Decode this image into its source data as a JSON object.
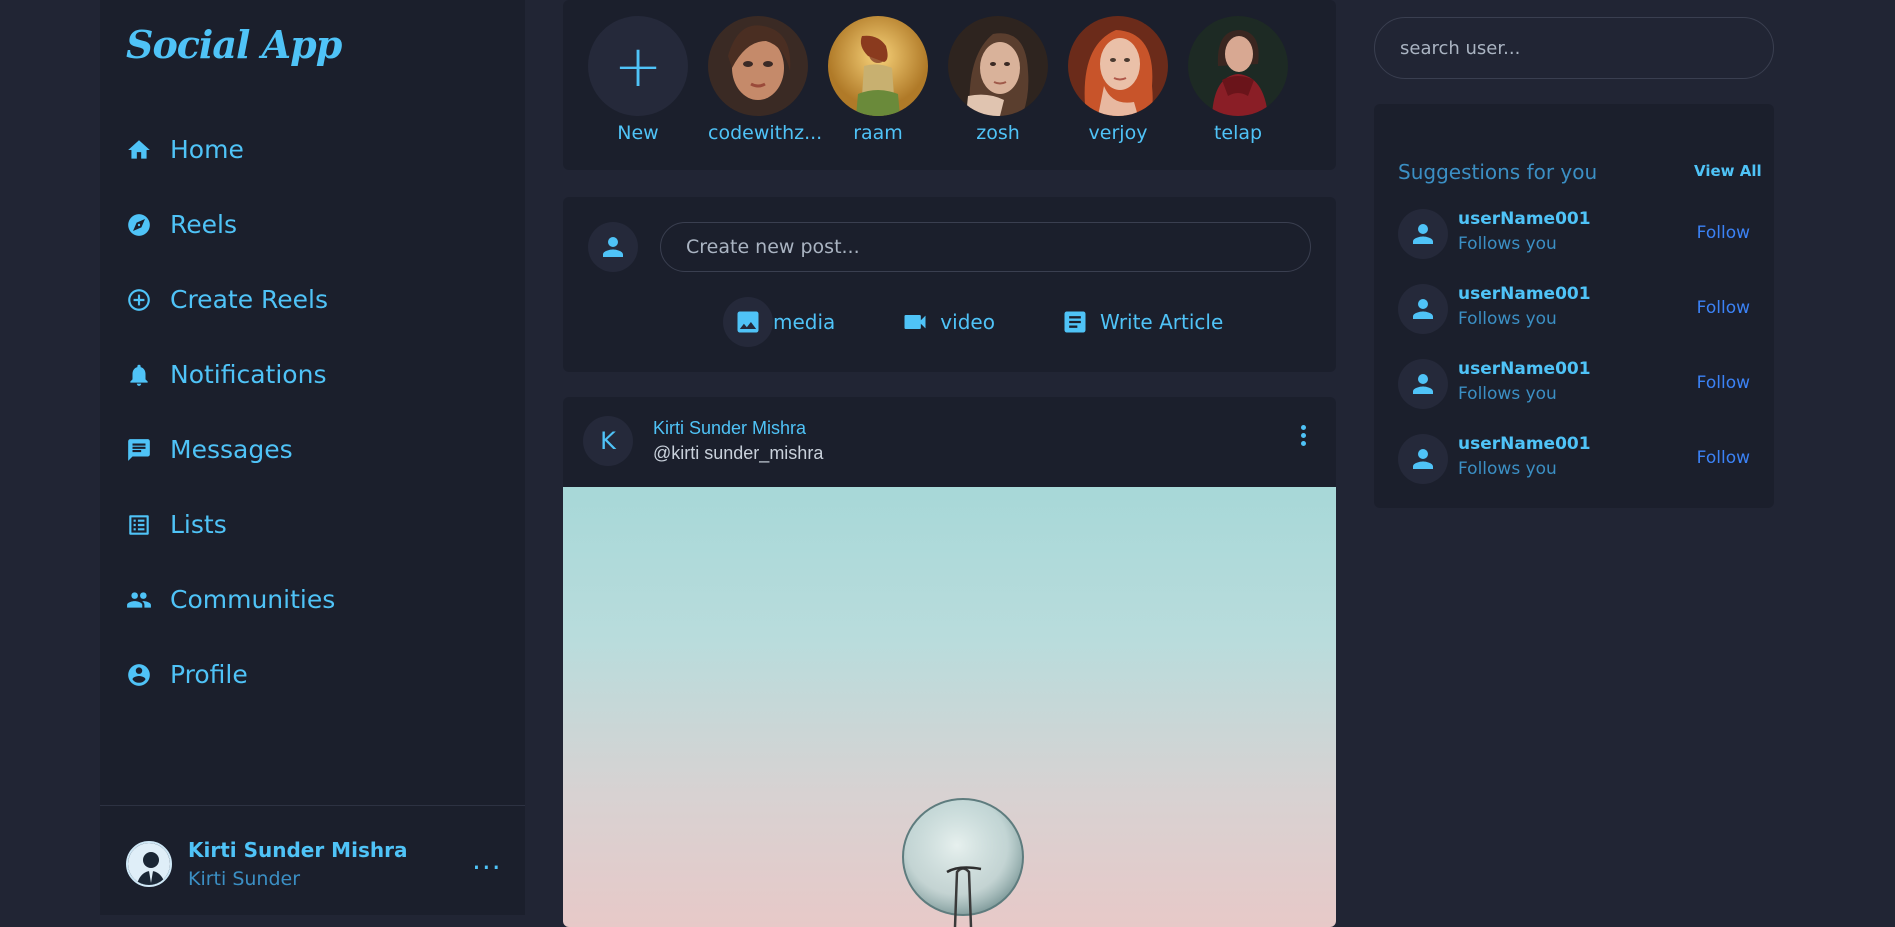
{
  "app": {
    "logo": "Social App"
  },
  "sidebar": {
    "items": [
      {
        "label": "Home",
        "icon": "home-icon"
      },
      {
        "label": "Reels",
        "icon": "compass-icon"
      },
      {
        "label": "Create Reels",
        "icon": "add-circle-icon"
      },
      {
        "label": "Notifications",
        "icon": "bell-icon"
      },
      {
        "label": "Messages",
        "icon": "message-icon"
      },
      {
        "label": "Lists",
        "icon": "list-icon"
      },
      {
        "label": "Communities",
        "icon": "group-icon"
      },
      {
        "label": "Profile",
        "icon": "account-circle-icon"
      }
    ],
    "profile": {
      "name": "Kirti Sunder Mishra",
      "handle": "Kirti Sunder",
      "menu": "..."
    }
  },
  "stories": {
    "new_label": "New",
    "items": [
      {
        "name": "codewithz...",
        "colors": [
          "#c58a6a",
          "#3a2a24"
        ]
      },
      {
        "name": "raam",
        "colors": [
          "#e8b24a",
          "#8a5a1e"
        ]
      },
      {
        "name": "zosh",
        "colors": [
          "#8c6a58",
          "#2e241f"
        ]
      },
      {
        "name": "verjoy",
        "colors": [
          "#d46a3a",
          "#6b2b1a"
        ]
      },
      {
        "name": "telap",
        "colors": [
          "#7a1e24",
          "#1d2a24"
        ]
      }
    ]
  },
  "composer": {
    "placeholder": "Create new post...",
    "actions": [
      {
        "label": "media",
        "icon": "image-icon"
      },
      {
        "label": "video",
        "icon": "videocam-icon"
      },
      {
        "label": "Write Article",
        "icon": "article-icon"
      }
    ]
  },
  "post": {
    "avatar_letter": "K",
    "author": "Kirti Sunder Mishra",
    "handle": "@kirti sunder_mishra"
  },
  "search": {
    "placeholder": "search user..."
  },
  "suggestions": {
    "title": "Suggestions for you",
    "view_all": "View All",
    "items": [
      {
        "name": "userName001",
        "sub": "Follows you",
        "action": "Follow"
      },
      {
        "name": "userName001",
        "sub": "Follows you",
        "action": "Follow"
      },
      {
        "name": "userName001",
        "sub": "Follows you",
        "action": "Follow"
      },
      {
        "name": "userName001",
        "sub": "Follows you",
        "action": "Follow"
      }
    ]
  },
  "colors": {
    "accent": "#4fc3f7",
    "follow": "#3b82f6",
    "bg": "#212534",
    "panel": "#1b1f2c"
  }
}
